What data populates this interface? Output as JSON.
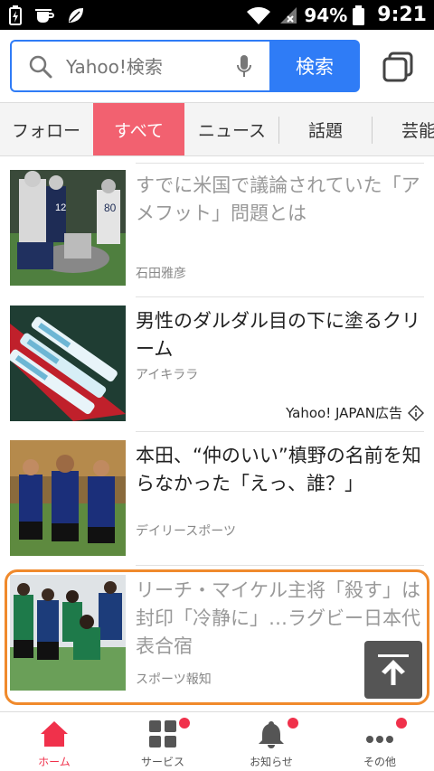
{
  "status_bar": {
    "battery_percent": "94%",
    "time": "9:21",
    "icons": [
      "battery-charging-icon",
      "coffee-cup-icon",
      "leaf-icon",
      "wifi-icon",
      "no-signal-icon",
      "battery-icon"
    ]
  },
  "search": {
    "placeholder": "Yahoo!検索",
    "button_label": "検索",
    "accent_color": "#2f7cf6"
  },
  "tabs": [
    {
      "label": "フォロー",
      "active": false
    },
    {
      "label": "すべて",
      "active": true
    },
    {
      "label": "ニュース",
      "active": false
    },
    {
      "label": "話題",
      "active": false
    },
    {
      "label": "芸能",
      "active": false
    }
  ],
  "articles": [
    {
      "title": "すでに米国で議論されていた「アメフット」問題とは",
      "source": "石田雅彦",
      "read": true
    },
    {
      "title": "男性のダルダル目の下に塗るクリーム",
      "source": "アイキララ",
      "ad_label": "Yahoo! JAPAN広告",
      "read": false
    },
    {
      "title": "本田、“仲のいい”槙野の名前を知らなかった「えっ、誰？」",
      "source": "デイリースポーツ",
      "read": false
    },
    {
      "title": "リーチ・マイケル主将「殺す」は封印「冷静に」…ラグビー日本代表合宿",
      "source": "スポーツ報知",
      "read": true
    }
  ],
  "bottom_nav": [
    {
      "label": "ホーム",
      "icon": "home-icon",
      "active": true,
      "badge": false
    },
    {
      "label": "サービス",
      "icon": "grid-icon",
      "active": false,
      "badge": true
    },
    {
      "label": "お知らせ",
      "icon": "bell-icon",
      "active": false,
      "badge": true
    },
    {
      "label": "その他",
      "icon": "more-icon",
      "active": false,
      "badge": true
    }
  ],
  "colors": {
    "active_tab": "#f26170",
    "highlight_border": "#f08a2c",
    "badge": "#f0314b"
  }
}
